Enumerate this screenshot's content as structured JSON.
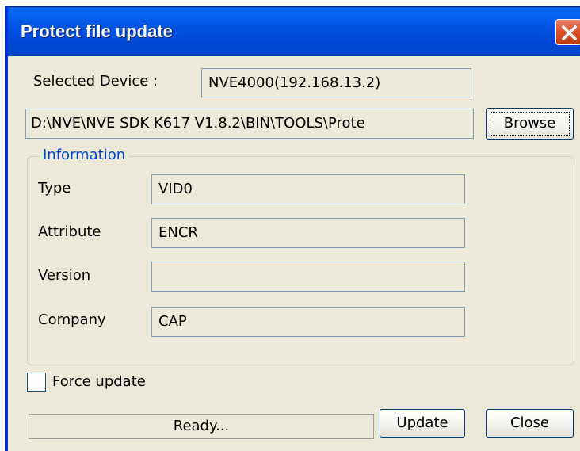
{
  "window": {
    "title": "Protect file update"
  },
  "device": {
    "label": "Selected Device :",
    "value": "NVE4000(192.168.13.2)"
  },
  "file": {
    "path": "D:\\NVE\\NVE SDK K617 V1.8.2\\BIN\\TOOLS\\Prote",
    "browse_label": "Browse"
  },
  "information": {
    "title": "Information",
    "type_label": "Type",
    "type_value": "VID0",
    "attribute_label": "Attribute",
    "attribute_value": "ENCR",
    "version_label": "Version",
    "version_value": "",
    "company_label": "Company",
    "company_value": "CAP"
  },
  "force_update": {
    "label": "Force update",
    "checked": false
  },
  "status": {
    "text": "Ready..."
  },
  "buttons": {
    "update_label": "Update",
    "close_label": "Close"
  },
  "icons": {
    "close": "close-icon"
  },
  "colors": {
    "titlebar": "#0054E3",
    "dialog_bg": "#ECE9D8",
    "group_title": "#0046D5",
    "close_button": "#D9552E"
  }
}
